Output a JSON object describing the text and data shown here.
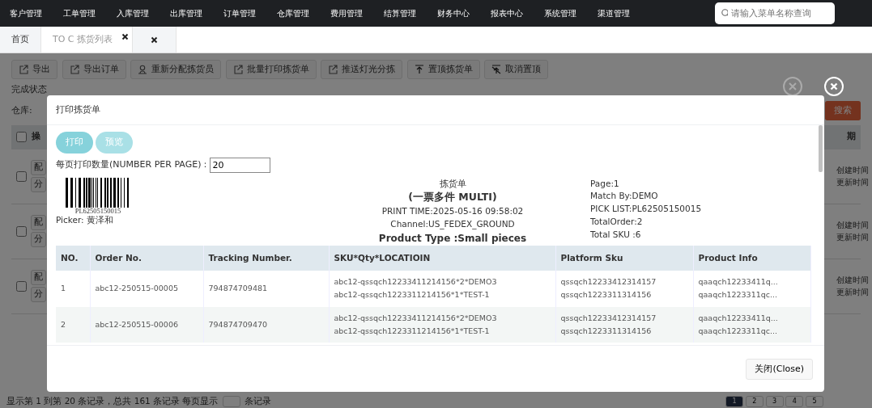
{
  "nav": {
    "items": [
      "客户管理",
      "工单管理",
      "入库管理",
      "出库管理",
      "订单管理",
      "仓库管理",
      "费用管理",
      "结算管理",
      "财务中心",
      "报表中心",
      "系统管理",
      "渠道管理"
    ],
    "search": {
      "placeholder": "请输入菜单名称查询"
    }
  },
  "tabs": [
    {
      "label": "首页",
      "selected": false,
      "closable": false
    },
    {
      "label": "TO C 拣货列表",
      "selected": true,
      "closable": true
    }
  ],
  "toolbar": [
    {
      "label": "导出",
      "kind": "export"
    },
    {
      "label": "导出订单",
      "kind": "export"
    },
    {
      "label": "重新分配拣货员",
      "kind": "user"
    },
    {
      "label": "批量打印拣货单",
      "kind": "export"
    },
    {
      "label": "推送灯光分拣",
      "kind": "export"
    },
    {
      "label": "置顶拣货单",
      "kind": "pin"
    },
    {
      "label": "取消置顶",
      "kind": "unpin"
    }
  ],
  "filter_label": "完成状态",
  "warehouse_label": "仓库:",
  "search_button": "搜索",
  "list": {
    "header_checked": false,
    "header_left": "操",
    "header_right": "期",
    "rows": [
      {
        "checked": false,
        "left": [
          "配",
          "分"
        ],
        "right": [
          "创建时间",
          "更新时间"
        ]
      },
      {
        "checked": false,
        "left": [
          "配",
          "分"
        ],
        "right": [
          "创建时间",
          "更新时间"
        ]
      },
      {
        "checked": false,
        "left": [
          "配",
          "分"
        ],
        "right": [
          "创建时间",
          "更新时间"
        ]
      }
    ]
  },
  "footer": {
    "summary": "显示第 1 到第 20 条记录，总共 161 条记录 每页显示",
    "suffix": "条记录",
    "pages": [
      {
        "label": "1",
        "selected": true
      },
      {
        "label": "2",
        "selected": false
      },
      {
        "label": "3",
        "selected": false
      },
      {
        "label": "4",
        "selected": false
      },
      {
        "label": "5",
        "selected": false
      }
    ]
  },
  "modal": {
    "title": "打印拣货单",
    "buttons": [
      {
        "label": "打印",
        "kind": "primary"
      },
      {
        "label": "预览",
        "kind": "secondary"
      }
    ],
    "per_page_label": "每页打印数量(NUMBER PER PAGE)：",
    "per_page_value": "20",
    "sheet": {
      "barcode_text": "PL62505150015",
      "picker": "Picker: 黄泽和",
      "title": "拣货单",
      "subtitle": "(一票多件 MULTI)",
      "print_time": "PRINT TIME:2025-05-16 09:58:02",
      "channel": "Channel:US_FEDEX_GROUND",
      "product_type": "Product Type :Small pieces",
      "info": [
        "Page:1",
        "Match By:DEMO",
        "PICK LIST:PL62505150015",
        "TotalOrder:2",
        "Total SKU :6"
      ]
    },
    "table": {
      "columns": [
        "NO.",
        "Order No.",
        "Tracking Number.",
        "SKU*Qty*LOCATIOIN",
        "Platform Sku",
        "Product Info"
      ],
      "rows": [
        [
          [
            "1"
          ],
          [
            "abc12-250515-00005"
          ],
          [
            "794874709481"
          ],
          [
            "abc12-qssqch12233411214156*2*DEMO3",
            "abc12-qssqch1223311214156*1*TEST-1"
          ],
          [
            "qssqch12233412314157",
            "qssqch1223311314156"
          ],
          [
            "qaaqch12233411q...",
            "qaaqch1223311qc..."
          ]
        ],
        [
          [
            "2"
          ],
          [
            "abc12-250515-00006"
          ],
          [
            "794874709470"
          ],
          [
            "abc12-qssqch12233411214156*2*DEMO3",
            "abc12-qssqch1223311214156*1*TEST-1"
          ],
          [
            "qssqch12233412314157",
            "qssqch1223311314156"
          ],
          [
            "qaaqch12233411q...",
            "qaaqch1223311qc..."
          ]
        ]
      ]
    },
    "close_button": "关闭(Close)"
  }
}
